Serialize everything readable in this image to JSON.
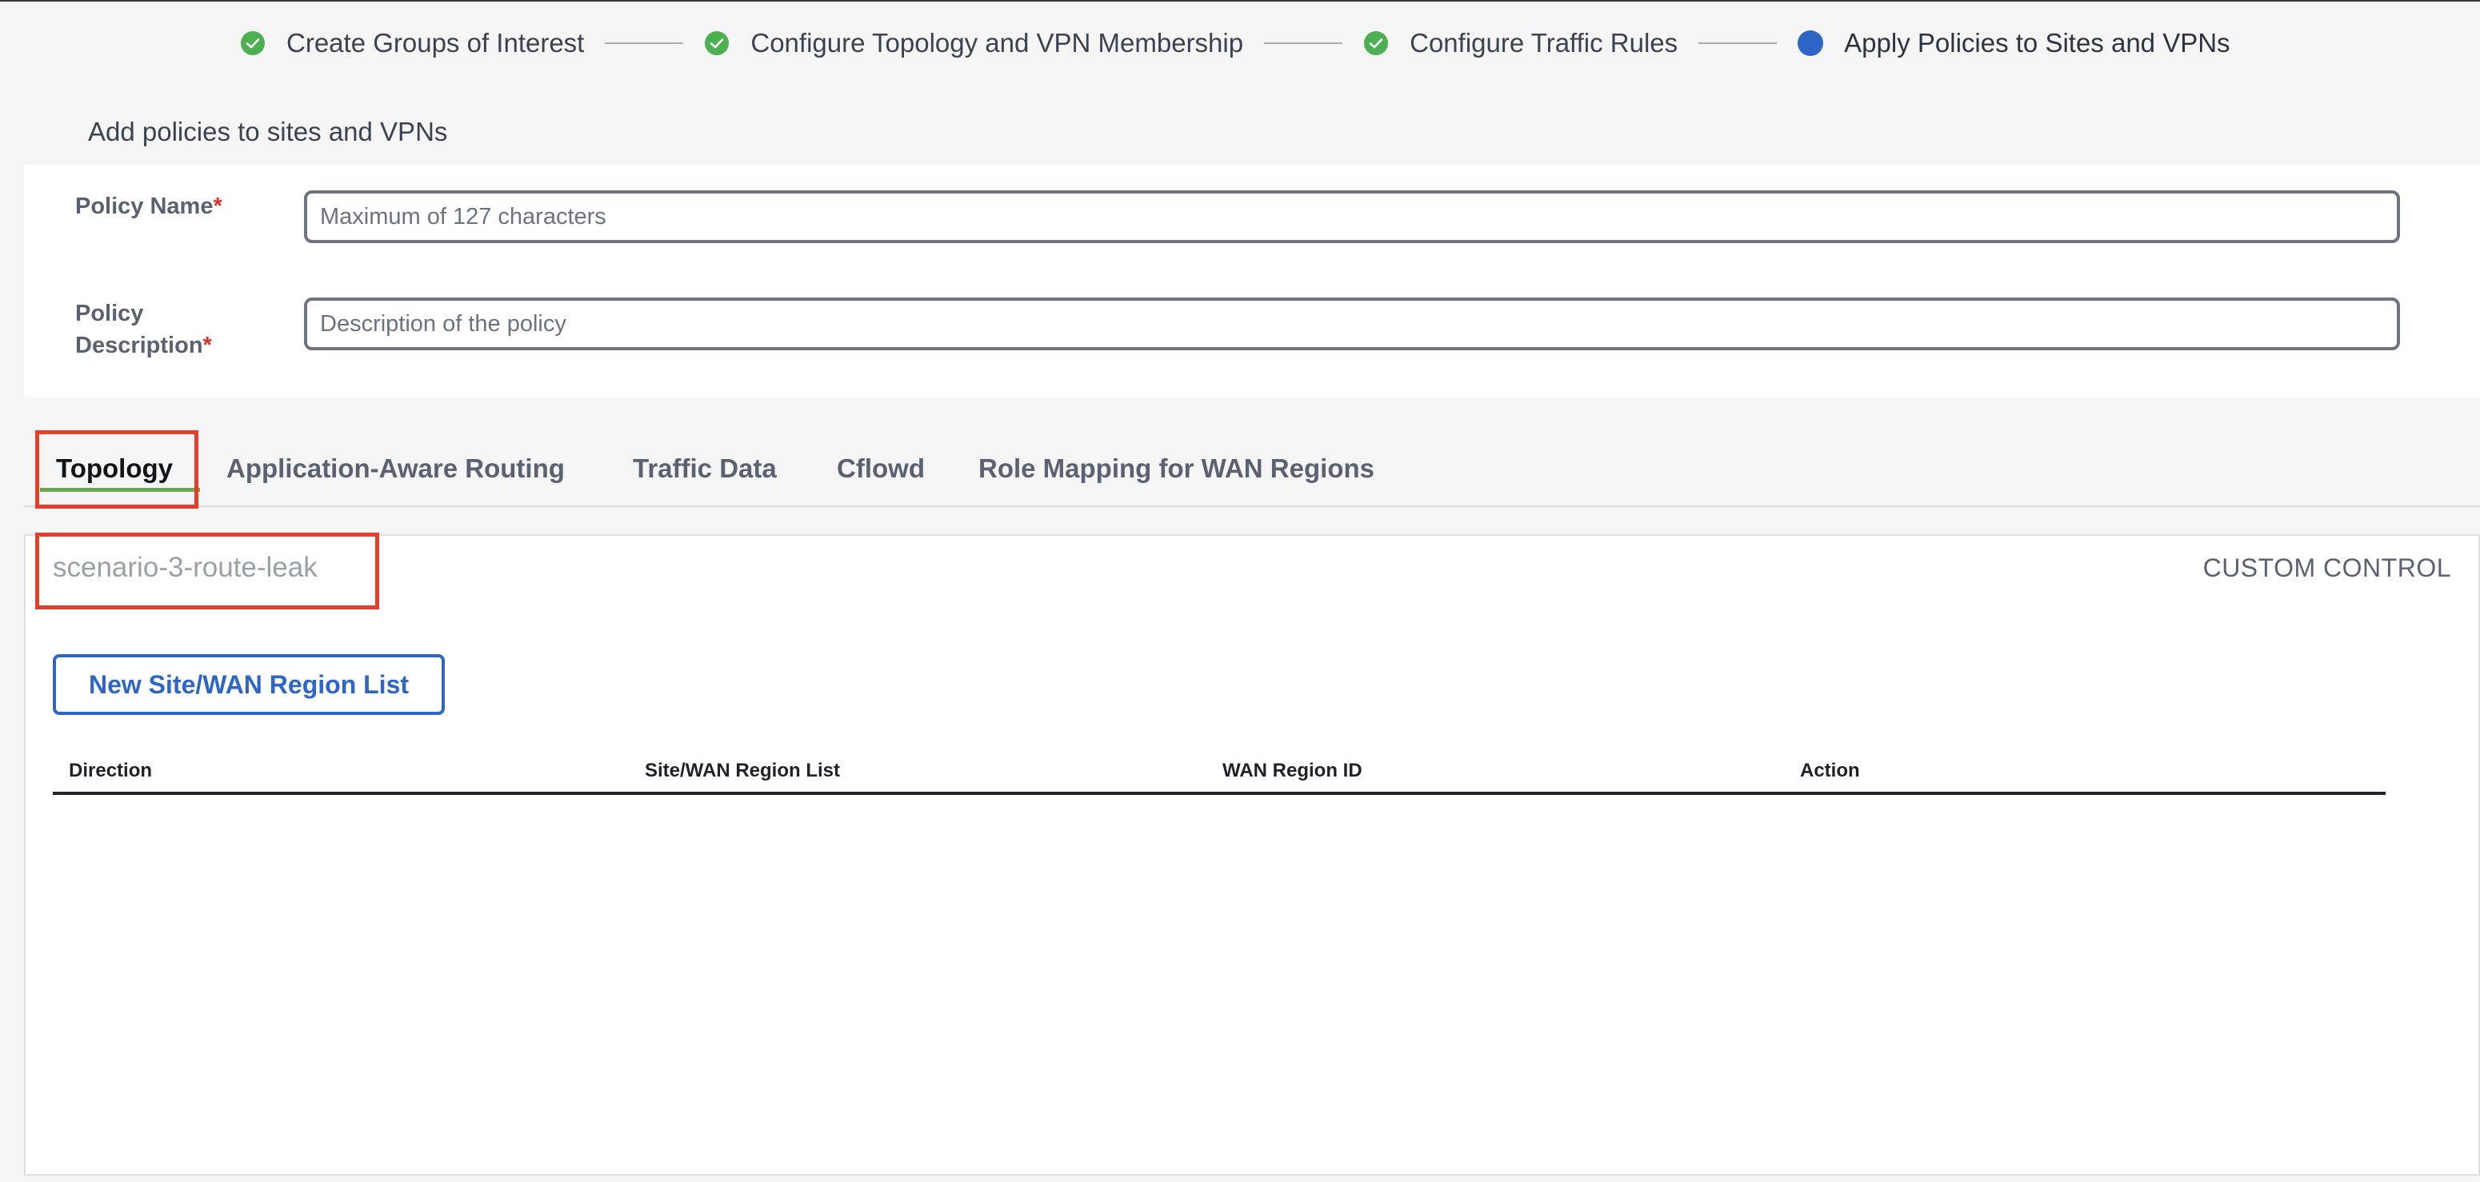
{
  "stepper": {
    "steps": [
      {
        "label": "Create Groups of Interest",
        "status": "complete",
        "icon": "check-circle-icon"
      },
      {
        "label": "Configure Topology and VPN Membership",
        "status": "complete",
        "icon": "check-circle-icon"
      },
      {
        "label": "Configure Traffic Rules",
        "status": "complete",
        "icon": "check-circle-icon"
      },
      {
        "label": "Apply Policies to Sites and VPNs",
        "status": "current",
        "icon": "current-step-dot"
      }
    ]
  },
  "section_heading": "Add policies to sites and VPNs",
  "form": {
    "policy_name": {
      "label": "Policy Name",
      "required_mark": "*",
      "placeholder": "Maximum of 127 characters",
      "value": ""
    },
    "policy_description": {
      "label_line1": "Policy",
      "label_line2": "Description",
      "required_mark": "*",
      "placeholder": "Description of the policy",
      "value": ""
    }
  },
  "tabs": [
    {
      "label": "Topology",
      "active": true
    },
    {
      "label": "Application-Aware Routing",
      "active": false
    },
    {
      "label": "Traffic Data",
      "active": false
    },
    {
      "label": "Cflowd",
      "active": false
    },
    {
      "label": "Role Mapping for WAN Regions",
      "active": false
    }
  ],
  "topology": {
    "policy_title": "scenario-3-route-leak",
    "control_type": "CUSTOM CONTROL",
    "new_list_button": "New Site/WAN Region List",
    "table_columns": [
      "Direction",
      "Site/WAN Region List",
      "WAN Region ID",
      "Action"
    ],
    "rows": []
  },
  "colors": {
    "success": "#4caf50",
    "accent": "#2e66c5",
    "required": "#d8342a",
    "highlight": "#e2402c",
    "tab_underline": "#6aa84f"
  }
}
